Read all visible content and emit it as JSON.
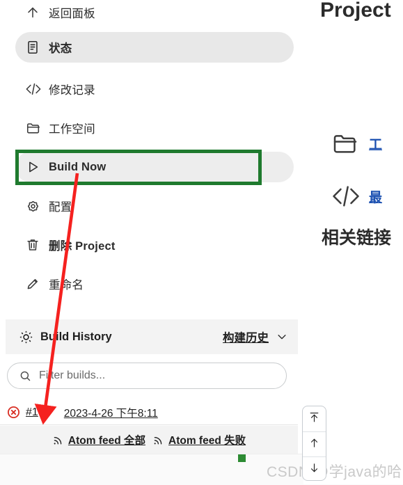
{
  "sidebar": {
    "items": [
      {
        "id": "back-to-dashboard",
        "label": "返回面板",
        "icon": "arrow-up-icon"
      },
      {
        "id": "status",
        "label": "状态",
        "icon": "document-icon"
      },
      {
        "id": "changes",
        "label": "修改记录",
        "icon": "code-icon"
      },
      {
        "id": "workspace",
        "label": "工作空间",
        "icon": "folder-icon"
      },
      {
        "id": "build-now",
        "label": "Build Now",
        "icon": "play-icon"
      },
      {
        "id": "configure",
        "label": "配置",
        "icon": "gear-icon"
      },
      {
        "id": "delete-project",
        "label": "删除 Project",
        "icon": "trash-icon"
      },
      {
        "id": "rename",
        "label": "重命名",
        "icon": "pencil-icon"
      }
    ]
  },
  "build_history": {
    "icon": "weather-icon",
    "title": "Build History",
    "link_label": "构建历史",
    "chevron": "chevron-down-icon",
    "filter_placeholder": "Filter builds...",
    "filter_value": "",
    "search_icon": "search-icon",
    "builds": [
      {
        "status_icon": "failed-icon",
        "number": "#1",
        "timestamp": "2023-4-26 下午8:11"
      }
    ],
    "feeds": [
      {
        "icon": "rss-icon",
        "label": "Atom feed 全部"
      },
      {
        "icon": "rss-icon",
        "label": "Atom feed 失败"
      }
    ]
  },
  "main": {
    "title": "Project",
    "links": [
      {
        "icon": "folder-icon",
        "label": "工"
      },
      {
        "icon": "code-icon",
        "label": "最"
      }
    ],
    "heading": "相关链接"
  },
  "scroll_controls": [
    {
      "id": "scroll-to-top",
      "icon": "arrow-to-top-icon"
    },
    {
      "id": "scroll-up",
      "icon": "arrow-up-icon"
    },
    {
      "id": "scroll-down",
      "icon": "arrow-down-icon"
    }
  ],
  "annotations": {
    "highlight_color": "#1f7a2e",
    "arrow_color": "#f5211f",
    "marker_color": "#2d8b33",
    "highlight_target": "Build Now",
    "arrow_from": "Build Now",
    "arrow_to": "#1"
  },
  "watermark": "CSDN @学java的哈哈"
}
